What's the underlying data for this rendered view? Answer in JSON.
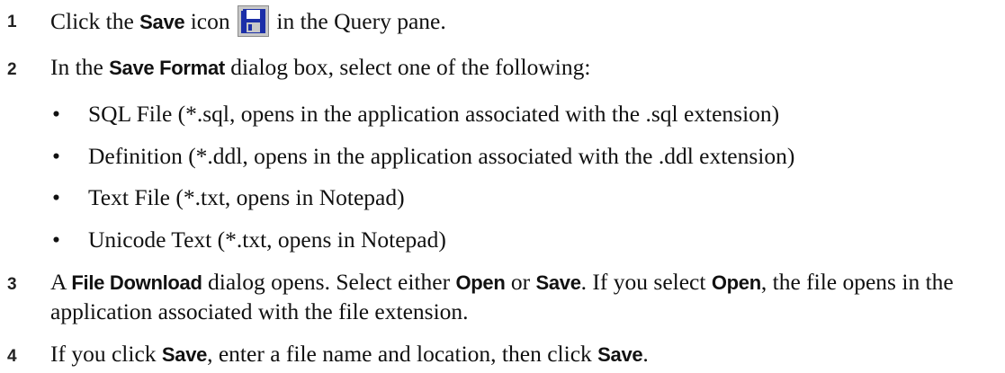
{
  "steps": [
    {
      "number": "1",
      "pre": "Click the ",
      "strong1": "Save",
      "mid": " icon ",
      "icon": "save-icon",
      "post": " in the Query pane."
    },
    {
      "number": "2",
      "pre": "In the ",
      "strong1": "Save Format",
      "post": " dialog box, select one of the following:",
      "bullets": [
        "SQL File (*.sql, opens in the application associated with the .sql extension)",
        "Definition (*.ddl, opens in the application associated with the .ddl extension)",
        "Text File (*.txt, opens in Notepad)",
        "Unicode Text (*.txt, opens in Notepad)"
      ]
    },
    {
      "number": "3",
      "pre": "A ",
      "strong1": "File Download",
      "t2": " dialog opens. Select either ",
      "strong2": "Open",
      "t3": " or ",
      "strong3": "Save",
      "t4": ". If you select ",
      "strong4": "Open",
      "t5": ", the file opens in the application associated with the file extension."
    },
    {
      "number": "4",
      "pre": "If you click ",
      "strong1": "Save",
      "t2": ", enter a file name and location, then click ",
      "strong2": "Save",
      "t3": "."
    }
  ],
  "bullet_glyph": "•",
  "colors": {
    "icon_blue": "#1c2fa8",
    "icon_bg": "#c8c8c8"
  }
}
